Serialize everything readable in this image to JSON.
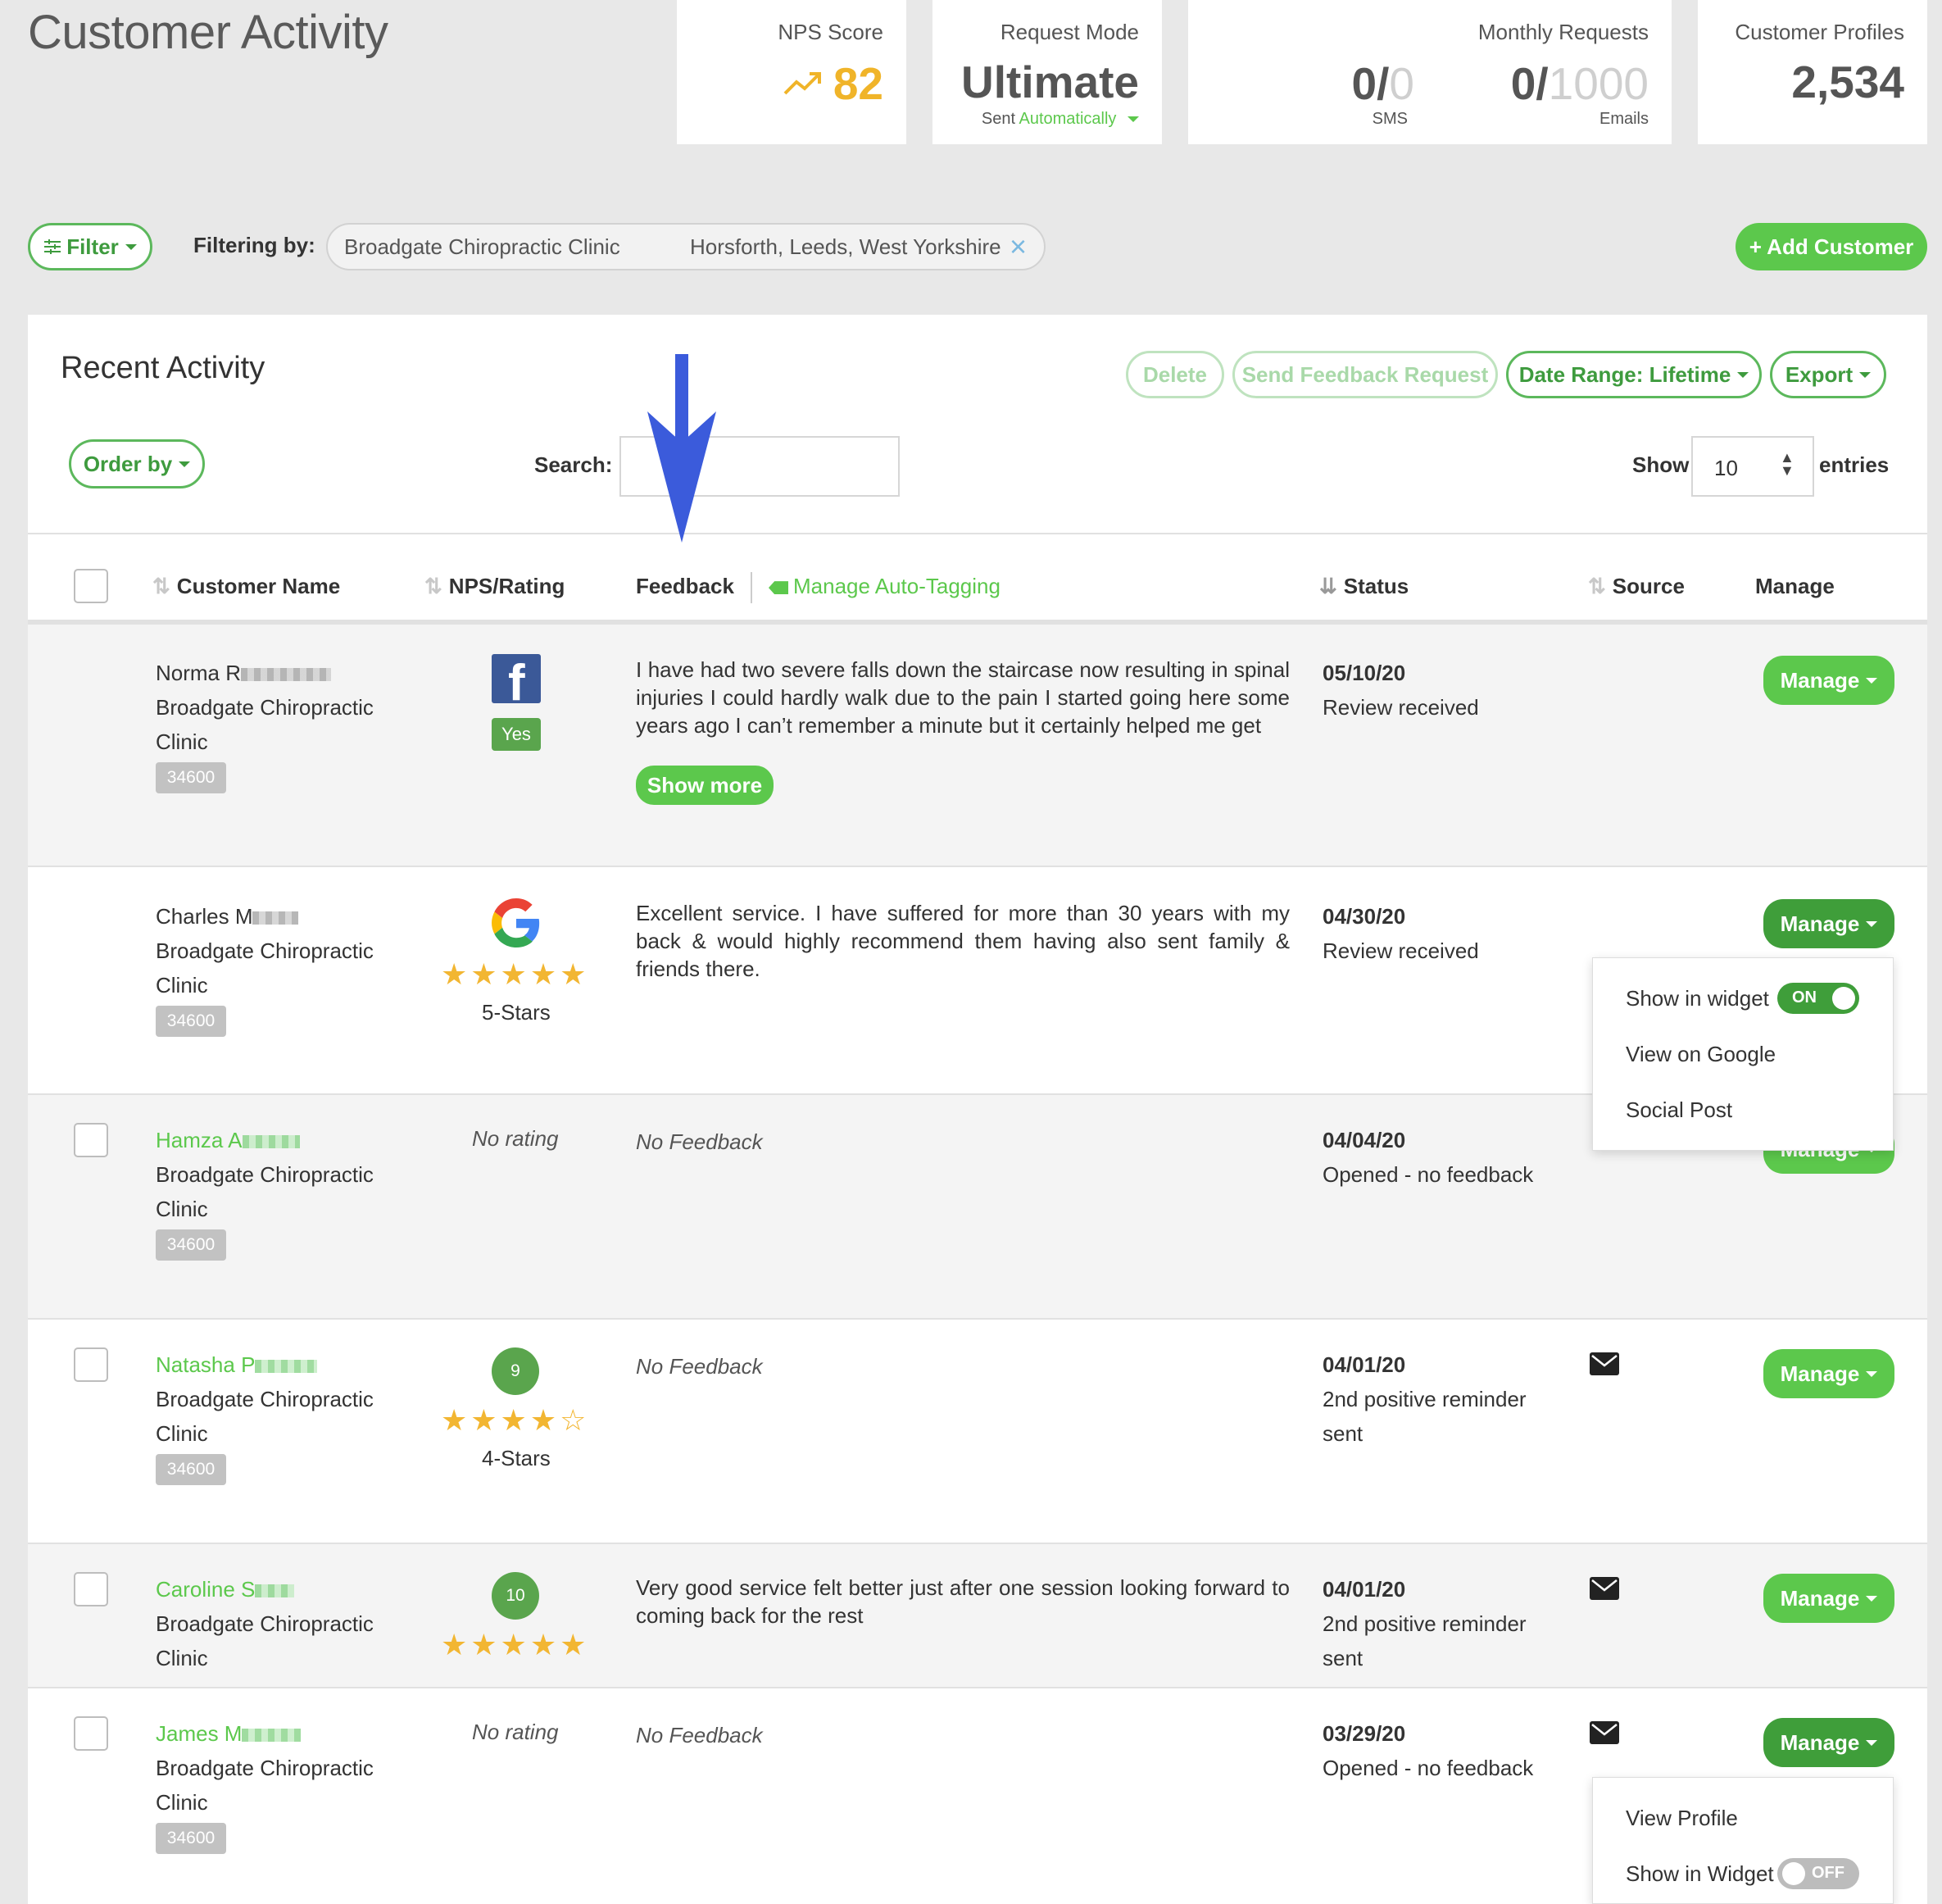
{
  "page_title": "Customer Activity",
  "stats": {
    "nps": {
      "label": "NPS Score",
      "value": "82",
      "color": "#f0b429"
    },
    "request_mode": {
      "label": "Request Mode",
      "value": "Ultimate",
      "sub_prefix": "Sent",
      "sub_link": "Automatically"
    },
    "monthly": {
      "label": "Monthly Requests",
      "sms_used": "0/",
      "sms_total": "0",
      "sms_label": "SMS",
      "email_used": "0/",
      "email_total": "1000",
      "email_label": "Emails"
    },
    "profiles": {
      "label": "Customer Profiles",
      "value": "2,534"
    }
  },
  "filter_bar": {
    "filter_label": "Filter",
    "filtering_by": "Filtering by:",
    "location_name": "Broadgate Chiropractic Clinic",
    "location_area": "Horsforth, Leeds, West Yorkshire",
    "add_customer": "+ Add Customer"
  },
  "panel": {
    "title": "Recent Activity",
    "delete": "Delete",
    "send_feedback": "Send Feedback Request",
    "date_range": "Date Range: Lifetime",
    "export": "Export",
    "order_by": "Order by",
    "search_label": "Search:",
    "search_value": "",
    "show_label": "Show",
    "entries_value": "10",
    "entries_label": "entries"
  },
  "table_headers": {
    "customer_name": "Customer Name",
    "nps_rating": "NPS/Rating",
    "feedback": "Feedback",
    "manage_auto_tagging": "Manage Auto-Tagging",
    "status": "Status",
    "source": "Source",
    "manage": "Manage"
  },
  "rows": [
    {
      "first": "Norma R",
      "clinic1": "Broadgate Chiropractic",
      "clinic2": "Clinic",
      "id": "34600",
      "rating_label": "Yes",
      "feedback": "I have had two severe falls down the staircase now resulting in spinal injuries I could hardly walk due to the pain I started going here some years ago I can’t remember a minute but it certainly helped me get",
      "show_more": "Show more",
      "date": "05/10/20",
      "status": "Review received",
      "manage": "Manage"
    },
    {
      "first": "Charles M",
      "clinic1": "Broadgate Chiropractic",
      "clinic2": "Clinic",
      "id": "34600",
      "stars": "★★★★★",
      "rating_label": "5-Stars",
      "feedback": "Excellent service. I have suffered for more than 30 years with my back & would highly recommend them having also sent family & friends there.",
      "date": "04/30/20",
      "status": "Review received",
      "manage": "Manage"
    },
    {
      "first": "Hamza A",
      "clinic1": "Broadgate Chiropractic",
      "clinic2": "Clinic",
      "id": "34600",
      "rating_label": "No rating",
      "feedback": "No Feedback",
      "date": "04/04/20",
      "status": "Opened - no feedback",
      "manage": "Manage"
    },
    {
      "first": "Natasha P",
      "clinic1": "Broadgate Chiropractic",
      "clinic2": "Clinic",
      "id": "34600",
      "nps": "9",
      "stars": "★★★★☆",
      "rating_label": "4-Stars",
      "feedback": "No Feedback",
      "date": "04/01/20",
      "status1": "2nd positive reminder",
      "status2": "sent",
      "manage": "Manage"
    },
    {
      "first": "Caroline S",
      "clinic1": "Broadgate Chiropractic",
      "clinic2": "Clinic",
      "nps": "10",
      "stars": "★★★★★",
      "feedback": "Very good service felt better just after one session looking forward to coming back for the rest",
      "date": "04/01/20",
      "status1": "2nd positive reminder",
      "status2": "sent",
      "manage": "Manage"
    },
    {
      "first": "James M",
      "clinic1": "Broadgate Chiropractic",
      "clinic2": "Clinic",
      "id": "34600",
      "rating_label": "No rating",
      "feedback": "No Feedback",
      "date": "03/29/20",
      "status": "Opened - no feedback",
      "manage": "Manage"
    }
  ],
  "menu1": {
    "show_in_widget": "Show in widget",
    "toggle": "ON",
    "view_google": "View on Google",
    "social_post": "Social Post"
  },
  "menu2": {
    "view_profile": "View Profile",
    "show_in_widget": "Show in Widget",
    "toggle": "OFF"
  },
  "colors": {
    "brand_green": "#5cc84c",
    "dark_green": "#3f9e3a",
    "link_green": "#5cc84c",
    "arrow_blue": "#3b5bdb",
    "facebook": "#3b5998",
    "star": "#f2b632"
  }
}
